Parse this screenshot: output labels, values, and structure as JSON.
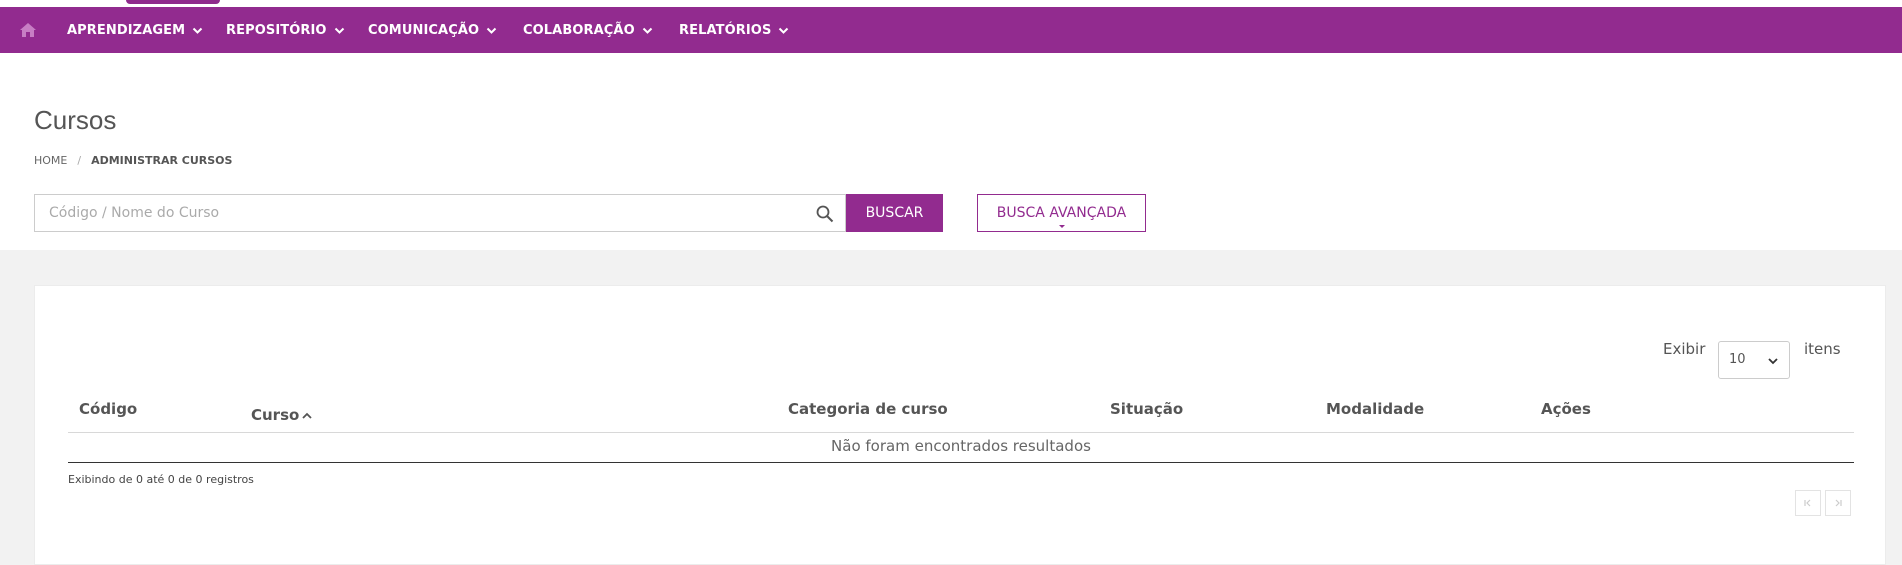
{
  "nav": {
    "home_icon": "home-icon",
    "items": [
      {
        "label": "APRENDIZAGEM"
      },
      {
        "label": "REPOSITÓRIO"
      },
      {
        "label": "COMUNICAÇÃO"
      },
      {
        "label": "COLABORAÇÃO"
      },
      {
        "label": "RELATÓRIOS"
      }
    ]
  },
  "page": {
    "title": "Cursos",
    "breadcrumb": {
      "home": "HOME",
      "separator": "/",
      "current": "ADMINISTRAR CURSOS"
    }
  },
  "search": {
    "placeholder": "Código / Nome do Curso",
    "value": "",
    "button_label": "BUSCAR",
    "advanced_label": "BUSCA AVANÇADA"
  },
  "table": {
    "show_label": "Exibir",
    "page_size": "10",
    "items_label": "itens",
    "columns": [
      "Código",
      "Curso",
      "Categoria de curso",
      "Situação",
      "Modalidade",
      "Ações"
    ],
    "empty_message": "Não foram encontrados resultados",
    "info": "Exibindo de 0 até 0 de 0 registros"
  },
  "colors": {
    "brand": "#922b8f",
    "header_bg": "#ffffff",
    "body_bg": "#f2f2f2"
  }
}
